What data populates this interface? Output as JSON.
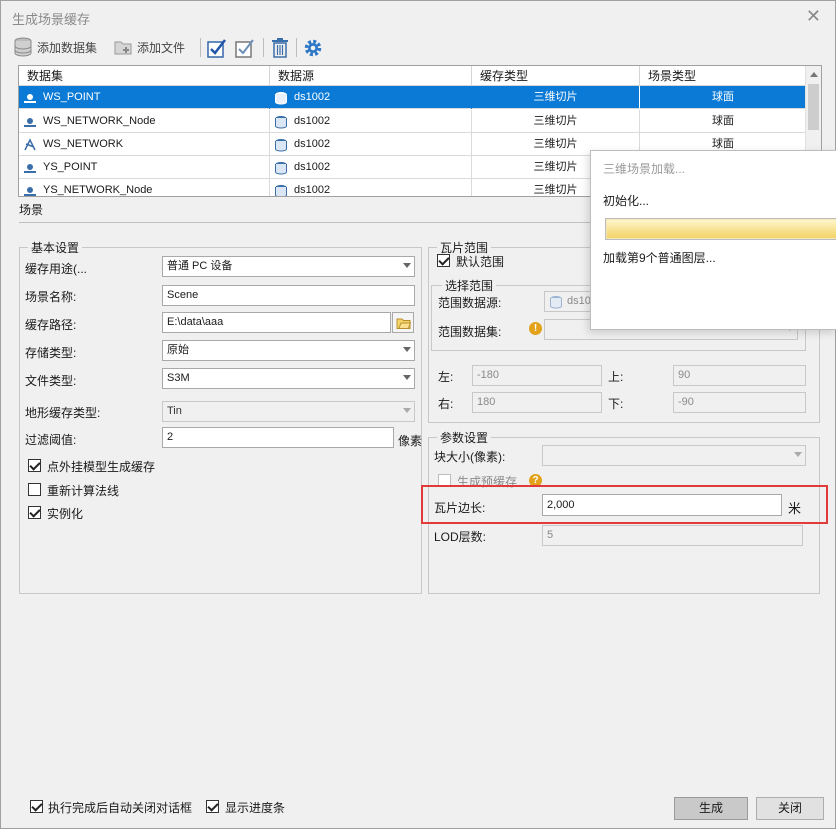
{
  "window": {
    "title": "生成场景缓存",
    "close_glyph": "✕"
  },
  "toolbar": {
    "add_dataset": "添加数据集",
    "add_file": "添加文件"
  },
  "grid": {
    "columns": [
      "数据集",
      "数据源",
      "缓存类型",
      "场景类型"
    ],
    "rows": [
      {
        "dataset": "WS_POINT",
        "datasource": "ds1002",
        "cache_type": "三维切片",
        "scene_type": "球面",
        "selected": true
      },
      {
        "dataset": "WS_NETWORK_Node",
        "datasource": "ds1002",
        "cache_type": "三维切片",
        "scene_type": "球面",
        "selected": false
      },
      {
        "dataset": "WS_NETWORK",
        "datasource": "ds1002",
        "cache_type": "三维切片",
        "scene_type": "球面",
        "selected": false
      },
      {
        "dataset": "YS_POINT",
        "datasource": "ds1002",
        "cache_type": "三维切片",
        "scene_type": "",
        "selected": false
      },
      {
        "dataset": "YS_NETWORK_Node",
        "datasource": "ds1002",
        "cache_type": "三维切片",
        "scene_type": "",
        "selected": false
      }
    ]
  },
  "tab": {
    "label": "场景"
  },
  "basic": {
    "title": "基本设置",
    "usage_label": "缓存用途(...",
    "usage_value": "普通 PC 设备",
    "name_label": "场景名称:",
    "name_value": "Scene",
    "path_label": "缓存路径:",
    "path_value": "E:\\data\\aaa",
    "storage_label": "存储类型:",
    "storage_value": "原始",
    "filetype_label": "文件类型:",
    "filetype_value": "S3M",
    "terrain_label": "地形缓存类型:",
    "terrain_value": "Tin",
    "filter_label": "过滤阈值:",
    "filter_value": "2",
    "filter_unit": "像素",
    "opt1": "点外挂模型生成缓存",
    "opt2": "重新计算法线",
    "opt3": "实例化"
  },
  "tile_range": {
    "title": "瓦片范围",
    "default_range": "默认范围",
    "select_title": "选择范围",
    "range_ds_label": "范围数据源:",
    "range_ds_value": "ds10",
    "range_dataset_label": "范围数据集:",
    "left_label": "左:",
    "left_value": "-180",
    "top_label": "上:",
    "top_value": "90",
    "right_label": "右:",
    "right_value": "180",
    "bottom_label": "下:",
    "bottom_value": "-90"
  },
  "params": {
    "title": "参数设置",
    "block_label": "块大小(像素):",
    "pre_cache": "生成预缓存",
    "tile_len_label": "瓦片边长:",
    "tile_len_value": "2,000",
    "tile_len_unit": "米",
    "lod_label": "LOD层数:",
    "lod_value": "5"
  },
  "popup": {
    "title": "三维场景加载...",
    "init": "初始化...",
    "loading": "加载第9个普通图层..."
  },
  "footer": {
    "auto_close": "执行完成后自动关闭对话框",
    "show_progress": "显示进度条",
    "generate": "生成",
    "close": "关闭"
  },
  "colors": {
    "selection": "#0a7ad6",
    "highlight": "#e03a3a",
    "warning": "#e3a21a"
  }
}
